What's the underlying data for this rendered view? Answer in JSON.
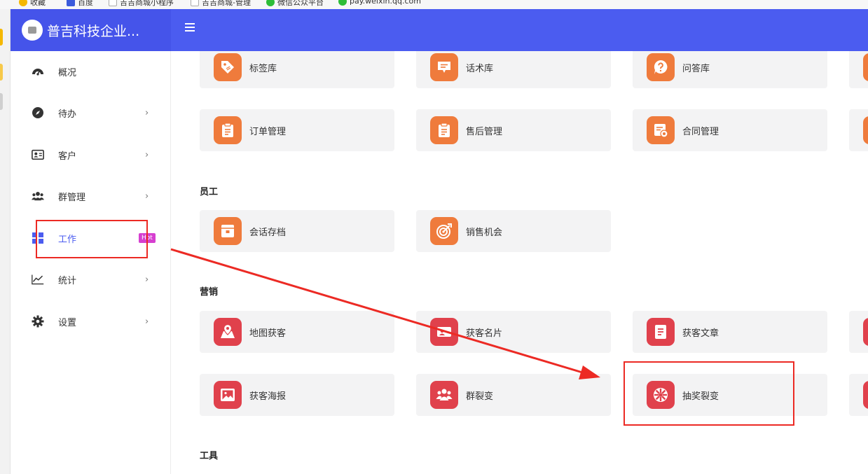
{
  "bookmarks": [
    {
      "label": "收藏",
      "color": "#f5b800"
    },
    {
      "label": "百度",
      "color": "#3b5bdb"
    },
    {
      "label": "吉吉商城小程序",
      "color": "#cccccc"
    },
    {
      "label": "吉吉商城-管理",
      "color": "#cccccc"
    },
    {
      "label": "微信公众平台",
      "color": "#2dbd38"
    },
    {
      "label": "pay.weixin.qq.com",
      "color": "#2dbd38"
    }
  ],
  "header": {
    "brand_title": "普吉科技企业..."
  },
  "sidebar": {
    "items": [
      {
        "label": "概况",
        "icon": "dashboard-icon",
        "chevron": ""
      },
      {
        "label": "待办",
        "icon": "compass-icon",
        "chevron": "›"
      },
      {
        "label": "客户",
        "icon": "contact-card-icon",
        "chevron": "›"
      },
      {
        "label": "群管理",
        "icon": "users-icon",
        "chevron": "›"
      },
      {
        "label": "工作",
        "icon": "grid-icon",
        "badge": "Hot",
        "chevron": ""
      },
      {
        "label": "统计",
        "icon": "line-chart-icon",
        "chevron": "›"
      },
      {
        "label": "设置",
        "icon": "gear-icon",
        "chevron": "›"
      }
    ]
  },
  "main": {
    "group1": {
      "cards": [
        {
          "label": "标签库",
          "icon": "tag-icon"
        },
        {
          "label": "话术库",
          "icon": "message-icon"
        },
        {
          "label": "问答库",
          "icon": "question-icon"
        },
        {
          "label": "订单管理",
          "icon": "clipboard-icon"
        },
        {
          "label": "售后管理",
          "icon": "clipboard-icon"
        },
        {
          "label": "合同管理",
          "icon": "contract-icon"
        }
      ]
    },
    "staff": {
      "title": "员工",
      "cards": [
        {
          "label": "会话存档",
          "icon": "archive-icon"
        },
        {
          "label": "销售机会",
          "icon": "target-icon"
        }
      ]
    },
    "marketing": {
      "title": "营销",
      "cards": [
        {
          "label": "地图获客",
          "icon": "map-icon"
        },
        {
          "label": "获客名片",
          "icon": "business-card-icon"
        },
        {
          "label": "获客文章",
          "icon": "article-icon"
        },
        {
          "label": "获客海报",
          "icon": "poster-icon"
        },
        {
          "label": "群裂变",
          "icon": "group-icon"
        },
        {
          "label": "抽奖裂变",
          "icon": "wheel-icon"
        }
      ]
    },
    "tools": {
      "title": "工具"
    }
  },
  "colors": {
    "header": "#4b5cf0",
    "orange_icon": "#ef7b3c",
    "red_icon": "#e0414c",
    "hot_badge": "#d63fd0",
    "annotation": "#ec2a24"
  }
}
